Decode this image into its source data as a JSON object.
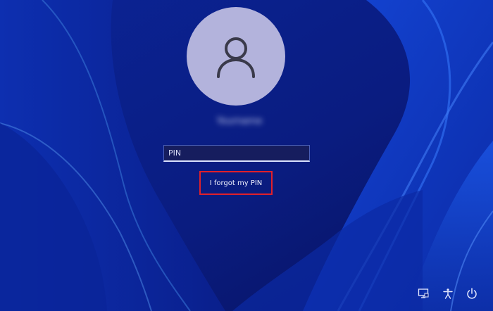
{
  "login": {
    "username": "Yourname",
    "pin_placeholder": "PIN",
    "forgot_pin_label": "I forgot my PIN"
  },
  "icons": {
    "avatar": "person-icon",
    "network": "network-icon",
    "accessibility": "accessibility-icon",
    "power": "power-icon"
  },
  "colors": {
    "background": "#0a1e86",
    "avatar": "#b3b3dc",
    "highlight_box": "#e0202a"
  }
}
